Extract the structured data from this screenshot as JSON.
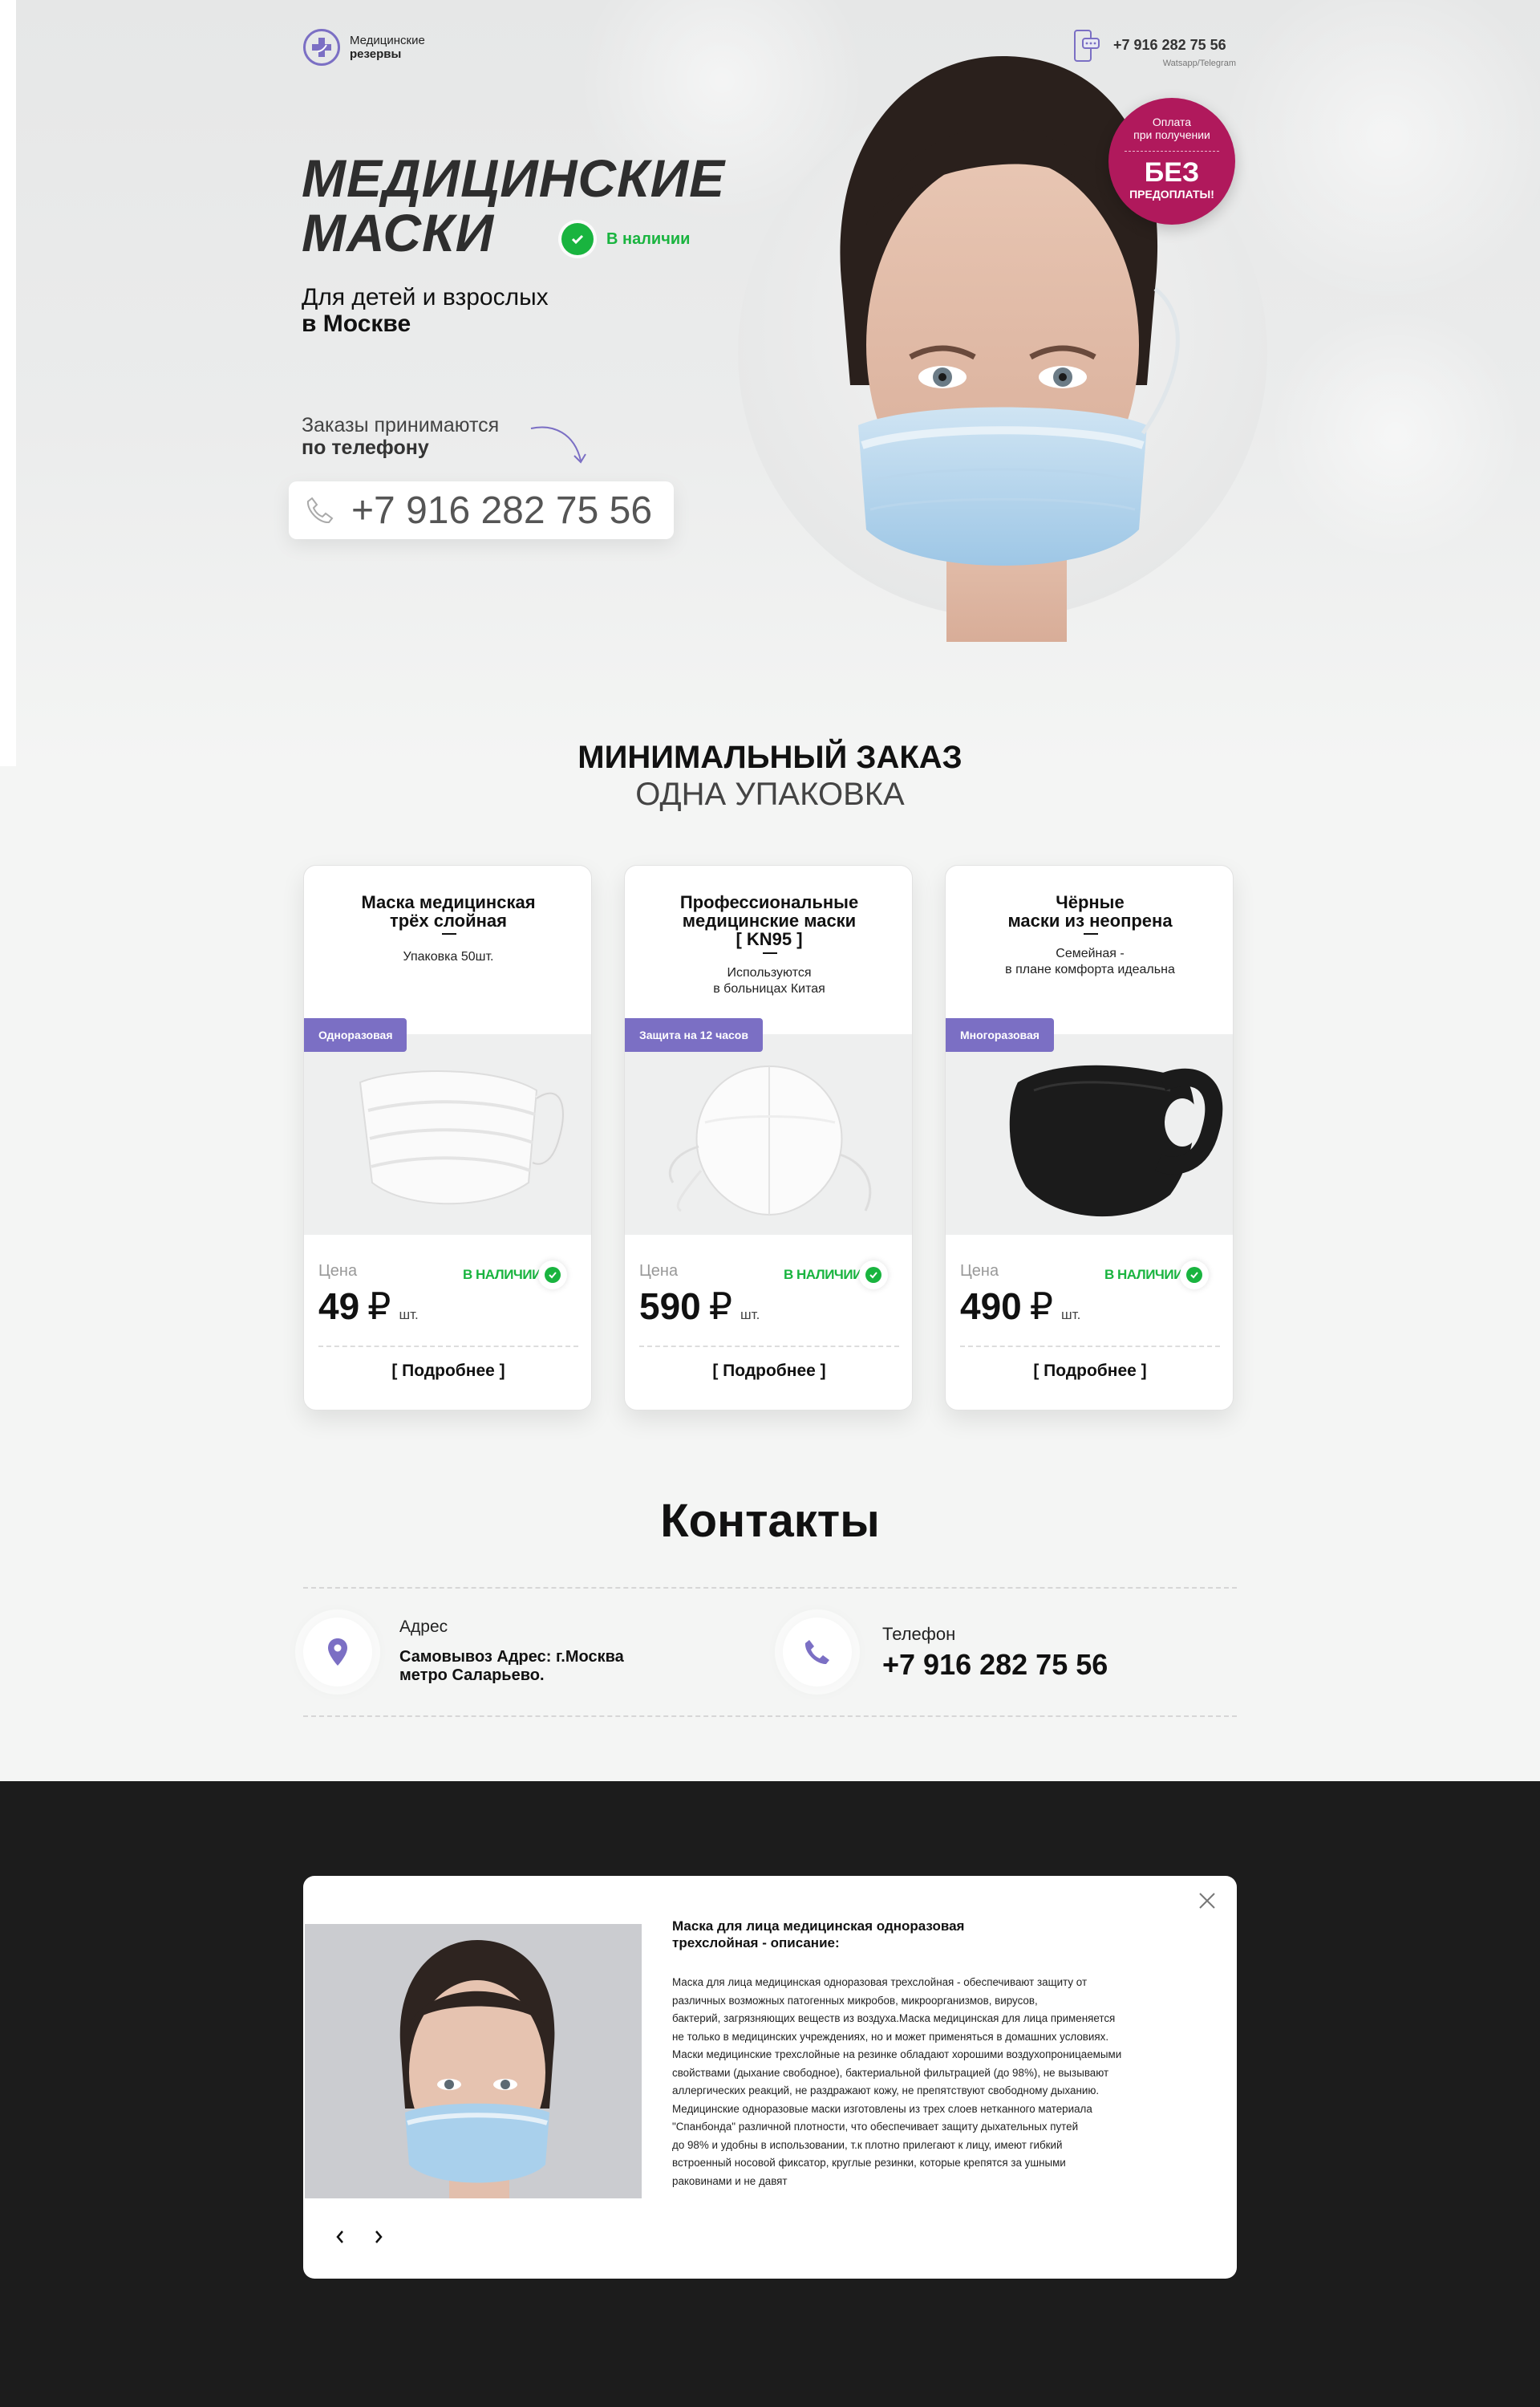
{
  "header": {
    "logo_line1": "Медицинские",
    "logo_line2": "резервы",
    "phone": "+7 916 282 75 56",
    "messengers": "Watsapp/Telegram"
  },
  "hero": {
    "title_line1": "МЕДИЦИНСКИЕ",
    "title_line2": "МАСКИ",
    "stock": "В наличии",
    "subtitle_line1": "Для детей и взрослых",
    "subtitle_line2": "в Москве",
    "orders_line1": "Заказы принимаются",
    "orders_line2": "по телефону",
    "phone": "+7 916 282 75 56",
    "badge_top_line1": "Оплата",
    "badge_top_line2": "при получении",
    "badge_mid": "БЕЗ",
    "badge_bottom": "ПРЕДОПЛАТЫ!"
  },
  "min_order": {
    "title": "МИНИМАЛЬНЫЙ ЗАКАЗ",
    "subtitle": "ОДНА УПАКОВКА"
  },
  "cards": [
    {
      "title": [
        "Маска медицинская",
        "трёх слойная"
      ],
      "desc": [
        "Упаковка 50шт."
      ],
      "tag": "Одноразовая",
      "price_label": "Цена",
      "stock": "В НАЛИЧИИ",
      "price": "49",
      "currency": "₽",
      "unit": "шт.",
      "more": "[ Подробнее ]"
    },
    {
      "title": [
        "Профессиональные",
        "медицинские маски",
        "[ KN95 ]"
      ],
      "desc": [
        "Используются",
        "в больницах Китая"
      ],
      "tag": "Защита на 12 часов",
      "price_label": "Цена",
      "stock": "В НАЛИЧИИ",
      "price": "590",
      "currency": "₽",
      "unit": "шт.",
      "more": "[ Подробнее ]"
    },
    {
      "title": [
        "Чёрные",
        "маски из неопрена"
      ],
      "desc": [
        "Семейная -",
        "в плане комфорта идеальна"
      ],
      "tag": "Многоразовая",
      "price_label": "Цена",
      "stock": "В НАЛИЧИИ",
      "price": "490",
      "currency": "₽",
      "unit": "шт.",
      "more": "[ Подробнее ]"
    }
  ],
  "contacts": {
    "title": "Контакты",
    "address_label": "Адрес",
    "address_line1": "Самовывоз Адрес: г.Москва",
    "address_line2": "метро Саларьево.",
    "phone_label": "Телефон",
    "phone": "+7 916 282 75 56"
  },
  "modal": {
    "title_line1": "Маска для лица медицинская одноразовая",
    "title_line2": "трехслойная  - описание:",
    "text": [
      "Маска для лица медицинская одноразовая трехслойная - обеспечивают защиту от",
      "различных возможных патогенных микробов, микроорганизмов, вирусов,",
      "бактерий, загрязняющих веществ из воздуха.Маска медицинская для лица применяется",
      "не только в медицинских учреждениях, но и может применяться в домашних условиях.",
      "Маски медицинские трехслойные на резинке обладают хорошими воздухопроницаемыми",
      "свойствами (дыхание свободное), бактериальной фильтрацией (до 98%), не вызывают",
      "аллергических реакций, не раздражают кожу, не препятствуют свободному дыханию.",
      "Медицинские одноразовые маски изготовлены из трех слоев нетканного материала",
      "\"Спанбонда\" различной плотности, что обеспечивает защиту дыхательных путей",
      "до 98% и удобны в использовании, т.к плотно прилегают  к лицу, имеют гибкий",
      "встроенный носовой фиксатор, круглые резинки, которые крепятся за ушными",
      "раковинами и не давят"
    ]
  },
  "icons": {
    "logo": "medical-cross-logo-icon",
    "header_phone": "smartphone-chat-icon",
    "check": "check-icon",
    "handset": "phone-handset-icon",
    "location": "location-pin-icon",
    "close": "close-icon",
    "prev": "chevron-left-icon",
    "next": "chevron-right-icon"
  },
  "colors": {
    "accent": "#7b6fc4",
    "in_stock": "#19b43f",
    "badge": "#b0195c",
    "dark_bg": "#1c1c1c"
  }
}
